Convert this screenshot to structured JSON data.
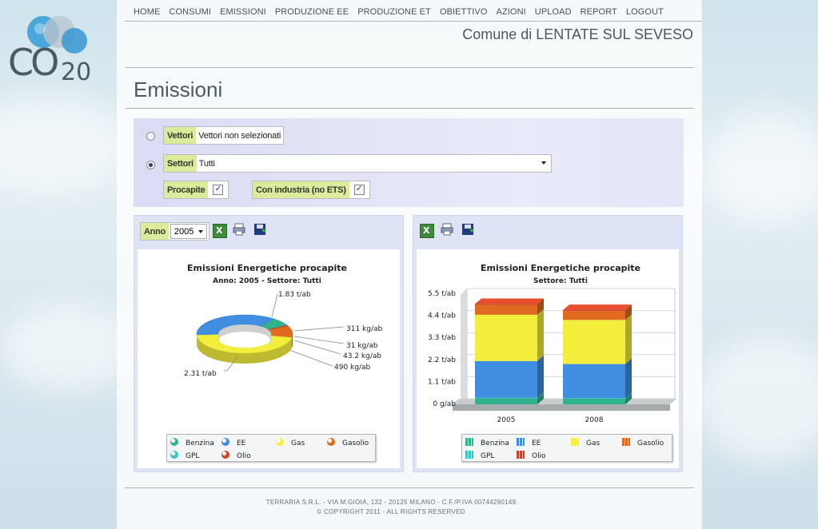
{
  "nav": [
    "HOME",
    "CONSUMI",
    "EMISSIONI",
    "PRODUZIONE EE",
    "PRODUZIONE ET",
    "OBIETTIVO",
    "AZIONI",
    "UPLOAD",
    "REPORT",
    "LOGOUT"
  ],
  "logo": {
    "text": "CO",
    "sub": "20"
  },
  "header": {
    "comune": "Comune di LENTATE SUL SEVESO"
  },
  "page_title": "Emissioni",
  "filters": {
    "vettori_label": "Vettori",
    "vettori_value": "Vettori non selezionati",
    "settori_label": "Settori",
    "settori_value": "Tutti",
    "procapite_label": "Procapite",
    "procapite_checked": "✓",
    "industria_label": "Con industria (no ETS)",
    "industria_checked": "✓"
  },
  "left_panel": {
    "anno_label": "Anno",
    "anno_value": "2005",
    "title": "Emissioni Energetiche procapite",
    "subtitle": "Anno: 2005 - Settore: Tutti"
  },
  "right_panel": {
    "title": "Emissioni Energetiche procapite",
    "subtitle": "Settore: Tutti"
  },
  "legend": [
    "Benzina",
    "EE",
    "Gas",
    "Gasolio",
    "GPL",
    "Olio"
  ],
  "colors": {
    "benzina": "#2fb38f",
    "ee": "#3f8ee0",
    "gas": "#f3ee3c",
    "gasolio": "#e06a1e",
    "gpl": "#38c7c0",
    "olio": "#c9452a"
  },
  "chart_data": [
    {
      "type": "pie",
      "labels": [
        "EE",
        "Benzina",
        "GPL",
        "Olio",
        "Gasolio",
        "Gas"
      ],
      "values": [
        1830,
        311,
        31,
        43.2,
        490,
        2310
      ],
      "data_labels": [
        "1.83 t/ab",
        "311 kg/ab",
        "31 kg/ab",
        "43.2 kg/ab",
        "490 kg/ab",
        "2.31 t/ab"
      ],
      "title": "Emissioni Energetiche procapite",
      "subtitle": "Anno: 2005 - Settore: Tutti"
    },
    {
      "type": "bar",
      "stacked": true,
      "categories": [
        "2005",
        "2008"
      ],
      "series": [
        {
          "name": "Benzina",
          "values": [
            0.3,
            0.28
          ]
        },
        {
          "name": "GPL",
          "values": [
            0.03,
            0.03
          ]
        },
        {
          "name": "EE",
          "values": [
            1.83,
            1.7
          ]
        },
        {
          "name": "Gas",
          "values": [
            2.31,
            2.2
          ]
        },
        {
          "name": "Gasolio",
          "values": [
            0.49,
            0.45
          ]
        },
        {
          "name": "Olio",
          "values": [
            0.04,
            0.04
          ]
        }
      ],
      "yticks": [
        "0 g/ab",
        "1.1 t/ab",
        "2.2 t/ab",
        "3.3 t/ab",
        "4.4 t/ab",
        "5.5 t/ab"
      ],
      "ylim": [
        0,
        5.5
      ],
      "title": "Emissioni Energetiche procapite",
      "subtitle": "Settore: Tutti"
    }
  ],
  "footer": {
    "line1": "TERRARIA S.R.L. - VIA M.GIOIA, 132 - 20125 MILANO - C.F./P.IVA 00744290149",
    "line2": "© COPYRIGHT 2011 - ALL RIGHTS RESERVED"
  }
}
